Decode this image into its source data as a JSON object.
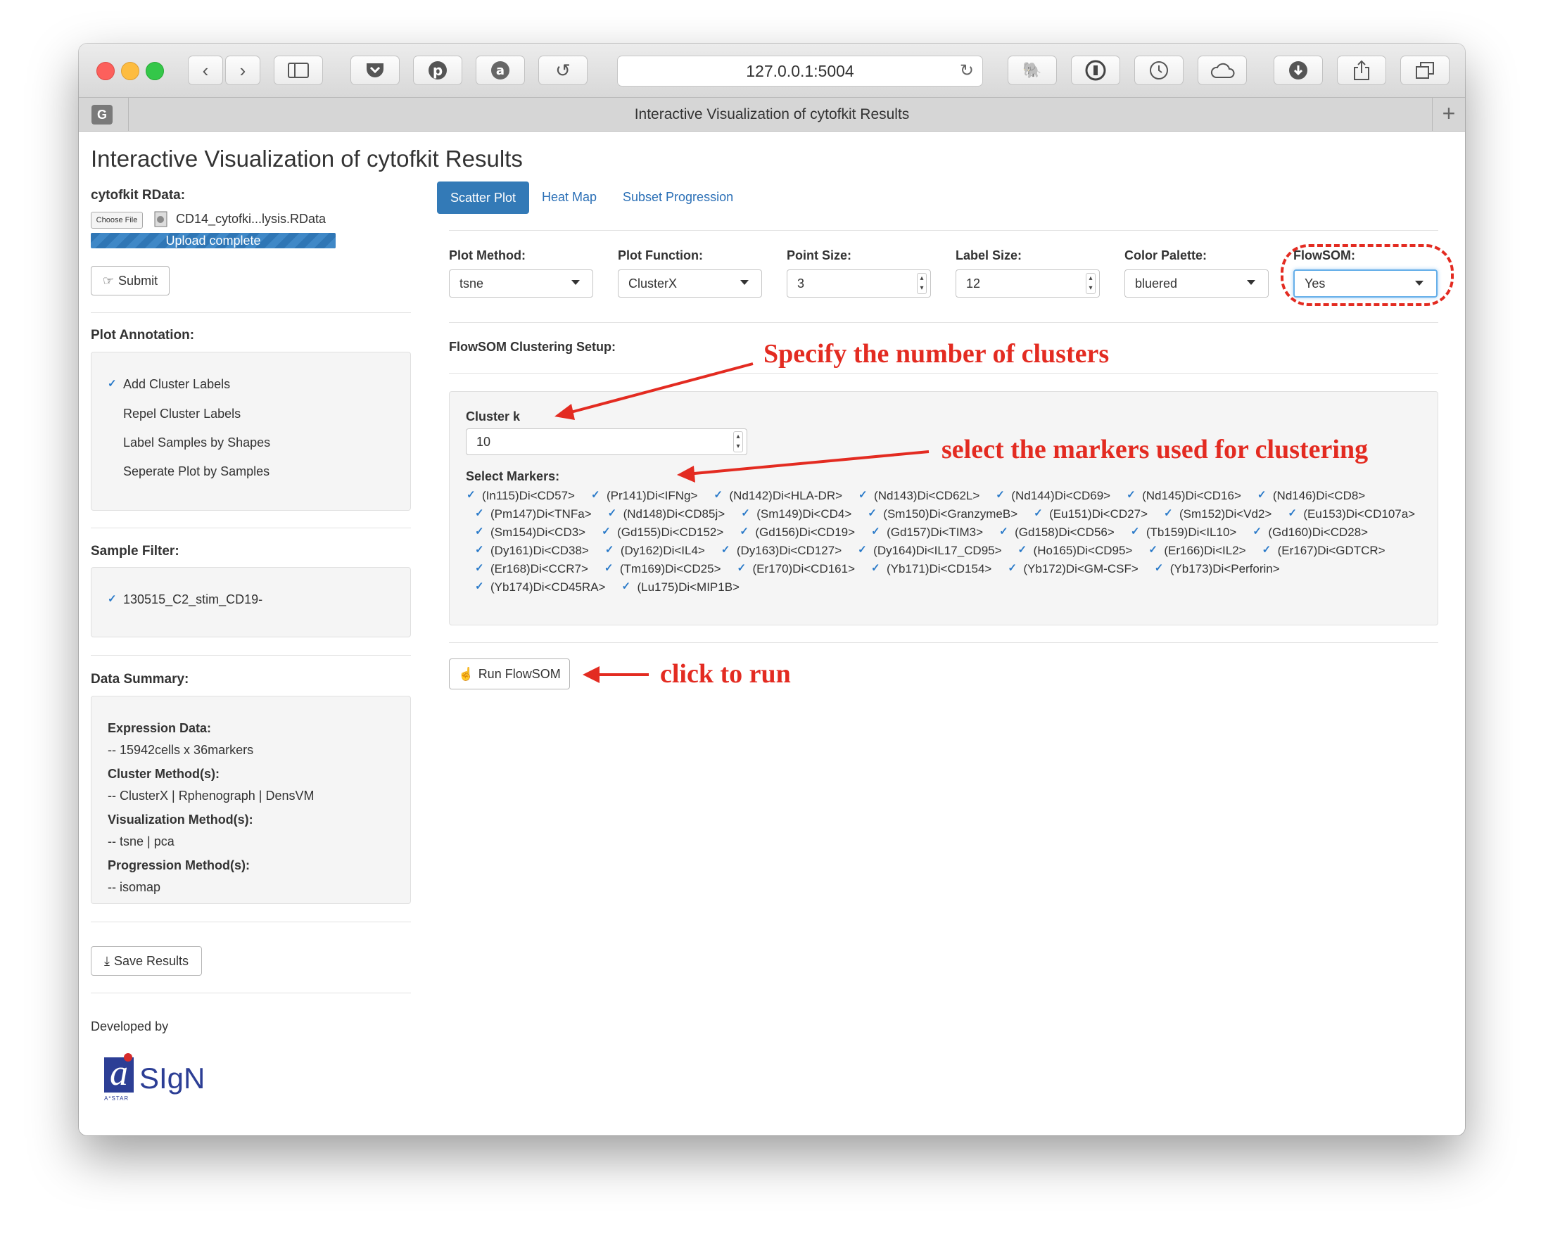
{
  "browser": {
    "url": "127.0.0.1:5004",
    "tab_title": "Interactive Visualization of cytofkit Results",
    "favicon_letter": "G",
    "new_tab_symbol": "+"
  },
  "page_title": "Interactive Visualization of cytofkit Results",
  "sidebar": {
    "rdata_label": "cytofkit RData:",
    "choose_file_label": "Choose File",
    "file_name": "CD14_cytofki...lysis.RData",
    "upload_status": "Upload complete",
    "submit_label": "Submit",
    "plot_annotation_label": "Plot Annotation:",
    "annotations": [
      {
        "label": "Add Cluster Labels",
        "checked": true
      },
      {
        "label": "Repel Cluster Labels",
        "checked": false
      },
      {
        "label": "Label Samples by Shapes",
        "checked": false
      },
      {
        "label": "Seperate Plot by Samples",
        "checked": false
      }
    ],
    "sample_filter_label": "Sample Filter:",
    "samples": [
      {
        "label": "130515_C2_stim_CD19-",
        "checked": true
      }
    ],
    "data_summary_label": "Data Summary:",
    "summary": {
      "expression_label": "Expression Data:",
      "expression_value": "-- 15942cells x 36markers",
      "cluster_label": "Cluster Method(s):",
      "cluster_value": "-- ClusterX | Rphenograph | DensVM",
      "visualization_label": "Visualization Method(s):",
      "visualization_value": "-- tsne | pca",
      "progression_label": "Progression Method(s):",
      "progression_value": "-- isomap"
    },
    "save_label": "Save Results",
    "developed_by": "Developed by",
    "logo_text": "SIgN",
    "logo_letter": "a",
    "logo_sub": "A*STAR"
  },
  "tabs": [
    {
      "label": "Scatter Plot",
      "active": true
    },
    {
      "label": "Heat Map",
      "active": false
    },
    {
      "label": "Subset Progression",
      "active": false
    }
  ],
  "controls": {
    "plot_method": {
      "label": "Plot Method:",
      "value": "tsne"
    },
    "plot_function": {
      "label": "Plot Function:",
      "value": "ClusterX"
    },
    "point_size": {
      "label": "Point Size:",
      "value": "3"
    },
    "label_size": {
      "label": "Label Size:",
      "value": "12"
    },
    "color_palette": {
      "label": "Color Palette:",
      "value": "bluered"
    },
    "flowsom": {
      "label": "FlowSOM:",
      "value": "Yes"
    }
  },
  "flowsom": {
    "setup_label": "FlowSOM Clustering Setup:",
    "cluster_k_label": "Cluster k",
    "cluster_k_value": "10",
    "select_markers_label": "Select Markers:",
    "marker_rows": [
      [
        "(In115)Di<CD57>",
        "(Pr141)Di<IFNg>",
        "(Nd142)Di<HLA-DR>",
        "(Nd143)Di<CD62L>",
        "(Nd144)Di<CD69>",
        "(Nd145)Di<CD16>",
        "(Nd146)Di<CD8>"
      ],
      [
        "(Pm147)Di<TNFa>",
        "(Nd148)Di<CD85j>",
        "(Sm149)Di<CD4>",
        "(Sm150)Di<GranzymeB>",
        "(Eu151)Di<CD27>",
        "(Sm152)Di<Vd2>",
        "(Eu153)Di<CD107a>"
      ],
      [
        "(Sm154)Di<CD3>",
        "(Gd155)Di<CD152>",
        "(Gd156)Di<CD19>",
        "(Gd157)Di<TIM3>",
        "(Gd158)Di<CD56>",
        "(Tb159)Di<IL10>",
        "(Gd160)Di<CD28>"
      ],
      [
        "(Dy161)Di<CD38>",
        "(Dy162)Di<IL4>",
        "(Dy163)Di<CD127>",
        "(Dy164)Di<IL17_CD95>",
        "(Ho165)Di<CD95>",
        "(Er166)Di<IL2>",
        "(Er167)Di<GDTCR>"
      ],
      [
        "(Er168)Di<CCR7>",
        "(Tm169)Di<CD25>",
        "(Er170)Di<CD161>",
        "(Yb171)Di<CD154>",
        "(Yb172)Di<GM-CSF>",
        "(Yb173)Di<Perforin>"
      ],
      [
        "(Yb174)Di<CD45RA>",
        "(Lu175)Di<MIP1B>"
      ]
    ],
    "run_label": "Run FlowSOM"
  },
  "annotations": {
    "clusters": "Specify the number of clusters",
    "markers": "select the markers used for clustering",
    "run": "click to run"
  },
  "colors": {
    "accent": "#337ab7",
    "annotation_red": "#e32b21",
    "checkbox_blue": "#2a7ac9"
  }
}
